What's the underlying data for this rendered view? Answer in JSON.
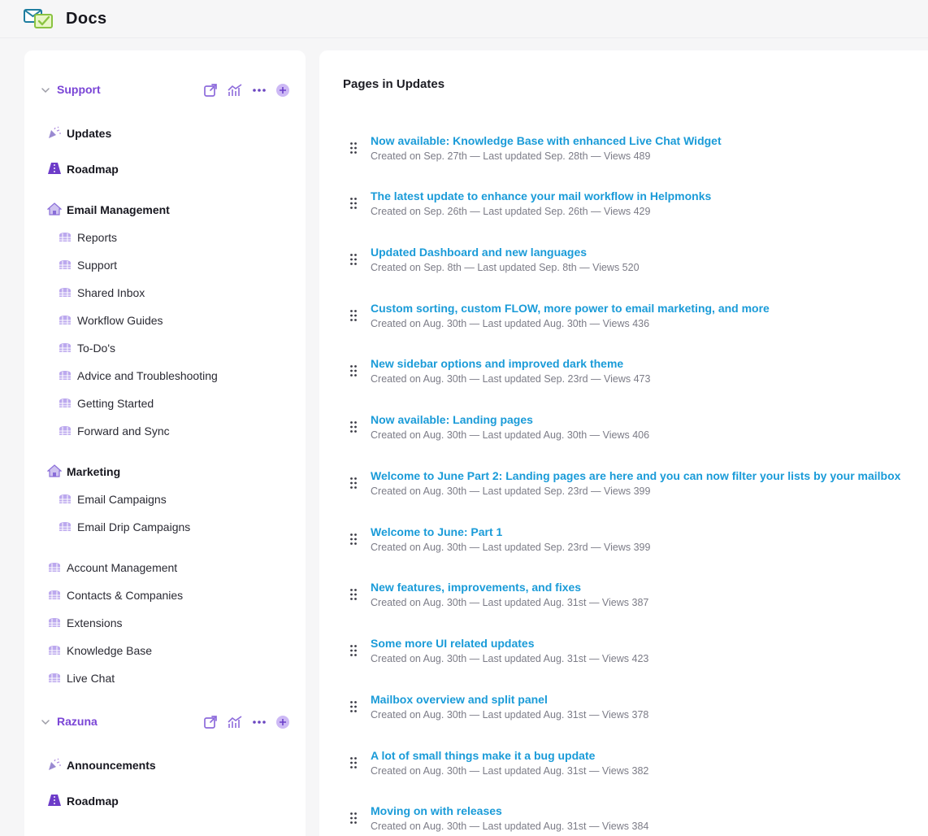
{
  "app": {
    "title": "Docs"
  },
  "colors": {
    "accent": "#7a45d6",
    "link": "#1a9bd8",
    "meta": "#7c7c87"
  },
  "sidebar": {
    "sections": [
      {
        "label": "Support",
        "icons": [
          "external-link-icon",
          "analytics-icon",
          "more-icon",
          "add-icon"
        ],
        "items": [
          {
            "label": "Updates",
            "icon": "party-popper-icon",
            "level": 1,
            "bold": true
          },
          {
            "label": "Roadmap",
            "icon": "road-icon",
            "level": 1,
            "bold": true
          },
          {
            "label": "Email Management",
            "icon": "home-icon",
            "level": 1,
            "bold": true
          },
          {
            "label": "Reports",
            "icon": "stack-icon",
            "level": 2,
            "bold": false
          },
          {
            "label": "Support",
            "icon": "stack-icon",
            "level": 2,
            "bold": false
          },
          {
            "label": "Shared Inbox",
            "icon": "stack-icon",
            "level": 2,
            "bold": false
          },
          {
            "label": "Workflow Guides",
            "icon": "stack-icon",
            "level": 2,
            "bold": false
          },
          {
            "label": "To-Do's",
            "icon": "stack-icon",
            "level": 2,
            "bold": false
          },
          {
            "label": "Advice and Troubleshooting",
            "icon": "stack-icon",
            "level": 2,
            "bold": false
          },
          {
            "label": "Getting Started",
            "icon": "stack-icon",
            "level": 2,
            "bold": false
          },
          {
            "label": "Forward and Sync",
            "icon": "stack-icon",
            "level": 2,
            "bold": false
          },
          {
            "label": "Marketing",
            "icon": "home-icon",
            "level": 1,
            "bold": true
          },
          {
            "label": "Email Campaigns",
            "icon": "stack-icon",
            "level": 2,
            "bold": false
          },
          {
            "label": "Email Drip Campaigns",
            "icon": "stack-icon",
            "level": 2,
            "bold": false
          },
          {
            "label": "Account Management",
            "icon": "stack-icon",
            "level": 1,
            "bold": false
          },
          {
            "label": "Contacts & Companies",
            "icon": "stack-icon",
            "level": 1,
            "bold": false
          },
          {
            "label": "Extensions",
            "icon": "stack-icon",
            "level": 1,
            "bold": false
          },
          {
            "label": "Knowledge Base",
            "icon": "stack-icon",
            "level": 1,
            "bold": false
          },
          {
            "label": "Live Chat",
            "icon": "stack-icon",
            "level": 1,
            "bold": false
          }
        ]
      },
      {
        "label": "Razuna",
        "icons": [
          "external-link-icon",
          "analytics-icon",
          "more-icon",
          "add-icon"
        ],
        "items": [
          {
            "label": "Announcements",
            "icon": "party-popper-icon",
            "level": 1,
            "bold": true
          },
          {
            "label": "Roadmap",
            "icon": "road-icon",
            "level": 1,
            "bold": true
          }
        ]
      }
    ]
  },
  "main": {
    "heading": "Pages in Updates",
    "pages": [
      {
        "title": "Now available: Knowledge Base with enhanced Live Chat Widget",
        "meta": "Created on Sep. 27th — Last updated Sep. 28th — Views 489"
      },
      {
        "title": "The latest update to enhance your mail workflow in Helpmonks",
        "meta": "Created on Sep. 26th — Last updated Sep. 26th — Views 429"
      },
      {
        "title": "Updated Dashboard and new languages",
        "meta": "Created on Sep. 8th — Last updated Sep. 8th — Views 520"
      },
      {
        "title": "Custom sorting, custom FLOW, more power to email marketing, and more",
        "meta": "Created on Aug. 30th — Last updated Aug. 30th — Views 436"
      },
      {
        "title": "New sidebar options and improved dark theme",
        "meta": "Created on Aug. 30th — Last updated Sep. 23rd — Views 473"
      },
      {
        "title": "Now available: Landing pages",
        "meta": "Created on Aug. 30th — Last updated Aug. 30th — Views 406"
      },
      {
        "title": "Welcome to June Part 2: Landing pages are here and you can now filter your lists by your mailbox",
        "meta": "Created on Aug. 30th — Last updated Sep. 23rd — Views 399"
      },
      {
        "title": "Welcome to June: Part 1",
        "meta": "Created on Aug. 30th — Last updated Sep. 23rd — Views 399"
      },
      {
        "title": "New features, improvements, and fixes",
        "meta": "Created on Aug. 30th — Last updated Aug. 31st — Views 387"
      },
      {
        "title": "Some more UI related updates",
        "meta": "Created on Aug. 30th — Last updated Aug. 31st — Views 423"
      },
      {
        "title": "Mailbox overview and split panel",
        "meta": "Created on Aug. 30th — Last updated Aug. 31st — Views 378"
      },
      {
        "title": "A lot of small things make it a bug update",
        "meta": "Created on Aug. 30th — Last updated Aug. 31st — Views 382"
      },
      {
        "title": "Moving on with releases",
        "meta": "Created on Aug. 30th — Last updated Aug. 31st — Views 384"
      }
    ]
  }
}
